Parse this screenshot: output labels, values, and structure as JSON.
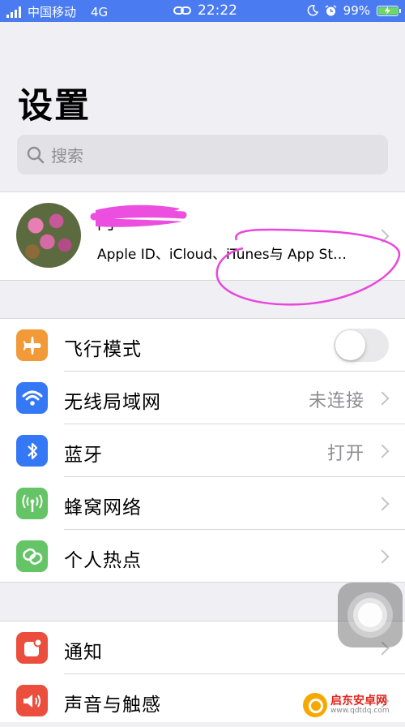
{
  "status_bar": {
    "carrier": "中国移动",
    "network": "4G",
    "time": "22:22",
    "battery_percent": "99%",
    "battery_level": 0.99,
    "icons": [
      "signal-bars-icon",
      "link-icon",
      "moon-icon",
      "alarm-icon",
      "battery-charging-icon"
    ],
    "bg_color": "#4a7bf0"
  },
  "page": {
    "title": "设置"
  },
  "search": {
    "placeholder": "搜索"
  },
  "profile": {
    "name": "阿",
    "subtitle": "Apple ID、iCloud、iTunes与 App St…"
  },
  "group1": [
    {
      "label": "飞行模式",
      "icon": "airplane-icon",
      "color": "#f19a37",
      "toggle": false
    },
    {
      "label": "无线局域网",
      "icon": "wifi-icon",
      "color": "#3478f6",
      "value": "未连接"
    },
    {
      "label": "蓝牙",
      "icon": "bluetooth-icon",
      "color": "#3478f6",
      "value": "打开"
    },
    {
      "label": "蜂窝网络",
      "icon": "cellular-icon",
      "color": "#65c466"
    },
    {
      "label": "个人热点",
      "icon": "hotspot-icon",
      "color": "#65c466"
    }
  ],
  "group2": [
    {
      "label": "通知",
      "icon": "notification-icon",
      "color": "#eb4e3d"
    },
    {
      "label": "声音与触感",
      "icon": "sound-icon",
      "color": "#eb4e3d"
    }
  ],
  "watermark": {
    "name": "启东安卓网",
    "url": "www.qdtdq.com"
  }
}
